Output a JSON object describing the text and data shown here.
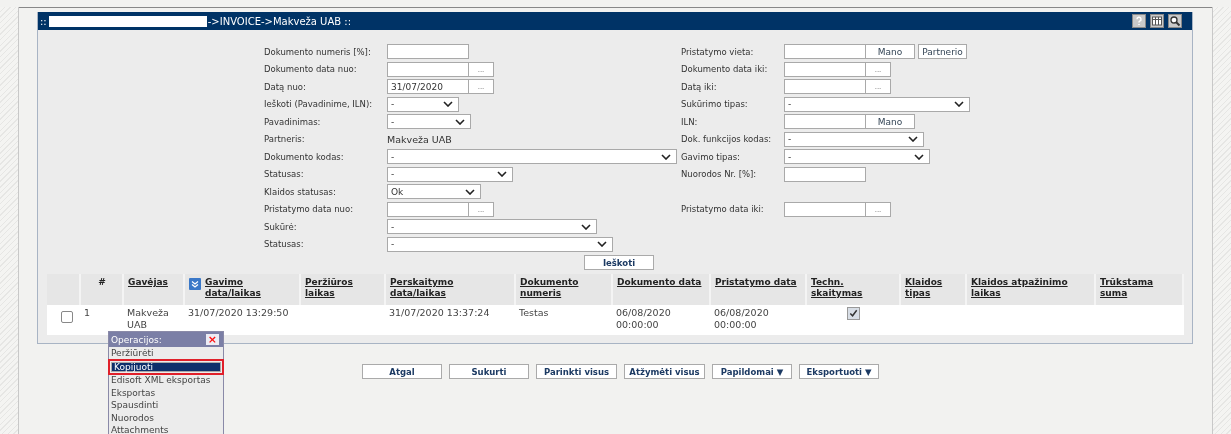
{
  "panel": {
    "title_prefix": "::",
    "title": "->INVOICE->Makveža UAB ::"
  },
  "form": {
    "rows": [
      {
        "left": {
          "label": "Dokumento numeris [%]:",
          "kind": "text"
        },
        "right": {
          "label": "Pristatymo vieta:",
          "kind": "text_buttons",
          "buttons": [
            "Mano",
            "Partnerio"
          ]
        }
      },
      {
        "left": {
          "label": "Dokumento data nuo:",
          "kind": "date",
          "button": "..."
        },
        "right": {
          "label": "Dokumento data iki:",
          "kind": "date",
          "button": "..."
        }
      },
      {
        "left": {
          "label": "Datą nuo:",
          "kind": "date",
          "value": "31/07/2020",
          "button": "..."
        },
        "right": {
          "label": "Datą iki:",
          "kind": "date",
          "button": "..."
        }
      },
      {
        "left": {
          "label": "Ieškoti (Pavadinime, ILN):",
          "kind": "select",
          "value": "-"
        },
        "right": {
          "label": "Sukūrimo tipas:",
          "kind": "select",
          "value": "-"
        }
      },
      {
        "left": {
          "label": "Pavadinimas:",
          "kind": "select",
          "value": "-"
        },
        "right": {
          "label": "ILN:",
          "kind": "text_buttons",
          "buttons": [
            "Mano"
          ]
        }
      },
      {
        "left": {
          "label": "Partneris:",
          "kind": "static",
          "value": "Makveža UAB"
        },
        "right": {
          "label": "Dok. funkcijos kodas:",
          "kind": "select",
          "value": "-"
        }
      },
      {
        "left": {
          "label": "Dokumento kodas:",
          "kind": "select",
          "value": "-"
        },
        "right": {
          "label": "Gavimo tipas:",
          "kind": "select",
          "value": "-"
        }
      },
      {
        "left": {
          "label": "Statusas:",
          "kind": "select",
          "value": "-"
        },
        "right": {
          "label": "Nuorodos Nr. [%]:",
          "kind": "text"
        }
      },
      {
        "left": {
          "label": "Klaidos statusas:",
          "kind": "select",
          "value": "Ok"
        }
      },
      {
        "left": {
          "label": "Pristatymo data nuo:",
          "kind": "date",
          "button": "..."
        },
        "right": {
          "label": "Pristatymo data iki:",
          "kind": "date",
          "button": "..."
        }
      },
      {
        "left": {
          "label": "Sukūrė:",
          "kind": "select",
          "value": "-"
        }
      },
      {
        "left": {
          "label": "Statusas:",
          "kind": "select",
          "value": "-"
        }
      }
    ],
    "search_button": "Ieškoti"
  },
  "table": {
    "columns": [
      {
        "label": "#",
        "sorted": false
      },
      {
        "label": "Gavėjas",
        "sorted": false
      },
      {
        "label": "Gavimo data/laikas",
        "sorted": true
      },
      {
        "label": "Peržiūros laikas",
        "sorted": false
      },
      {
        "label": "Perskaitymo data/laikas",
        "sorted": false
      },
      {
        "label": "Dokumento numeris",
        "sorted": false
      },
      {
        "label": "Dokumento data",
        "sorted": false
      },
      {
        "label": "Pristatymo data",
        "sorted": false
      },
      {
        "label": "Techn. skaitymas",
        "sorted": false
      },
      {
        "label": "Klaidos tipas",
        "sorted": false
      },
      {
        "label": "Klaidos atpažinimo laikas",
        "sorted": false
      },
      {
        "label": "Trūkstama suma",
        "sorted": false
      }
    ],
    "rows": [
      {
        "checked": false,
        "cells": [
          "1",
          "Makveža UAB",
          "31/07/2020 13:29:50",
          "",
          "31/07/2020 13:37:24",
          "Testas",
          "06/08/2020 00:00:00",
          "06/08/2020 00:00:00"
        ],
        "techn_checked": true
      }
    ]
  },
  "operations_menu": {
    "title": "Operacijos:",
    "close": "×",
    "items": [
      {
        "label": "Peržiūrėti",
        "selected": false
      },
      {
        "label": "Kopijuoti",
        "selected": true
      },
      {
        "label": "Edisoft XML eksportas",
        "selected": false
      },
      {
        "label": "Eksportas",
        "selected": false
      },
      {
        "label": "Spausdinti",
        "selected": false
      },
      {
        "label": "Nuorodos",
        "selected": false
      },
      {
        "label": "Attachments",
        "selected": false
      }
    ]
  },
  "buttons": [
    "Atgal",
    "Sukurti",
    "Parinkti visus",
    "Atžymėti visus",
    "Papildomai ▼",
    "Eksportuoti ▼"
  ]
}
